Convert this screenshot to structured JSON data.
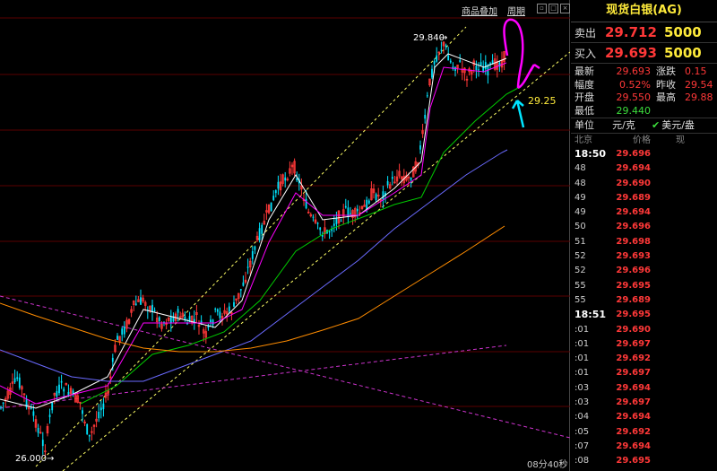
{
  "toolbar": {
    "btn_overlay": "商品叠加",
    "btn_period": "周期"
  },
  "chart": {
    "top_price_label": "29.840",
    "bottom_price_label": "26.000",
    "annotation": "29.25",
    "timer": "08分40秒",
    "colors": {
      "candle": "#ff3838",
      "ma_fast": "#ffffff",
      "ma2": "#ff00ff",
      "ma3": "#00cc00",
      "ma4": "#6a6aff",
      "ma5": "#ff8c00",
      "channel": "#ffff66",
      "trend": "#cc33cc",
      "annot": "#00e5ff",
      "mark": "#ff00ff"
    }
  },
  "side": {
    "title": "现货白银(AG)",
    "ask": {
      "label": "卖出",
      "price": "29.712",
      "volume": "5000"
    },
    "bid": {
      "label": "买入",
      "price": "29.693",
      "volume": "5000"
    },
    "stats": [
      {
        "l1": "最新",
        "v1": "29.693",
        "l2": "涨跌",
        "v2": "0.15"
      },
      {
        "l1": "幅度",
        "v1": "0.52%",
        "l2": "昨收",
        "v2": "29.54"
      },
      {
        "l1": "开盘",
        "v1": "29.550",
        "l2": "最高",
        "v2": "29.88"
      },
      {
        "l1": "最低",
        "v1": "29.440",
        "l2": "",
        "v2": ""
      }
    ],
    "unit": {
      "label": "单位",
      "value": "元/克",
      "option": "美元/盎"
    },
    "cols": {
      "c1": "北京",
      "c2": "价格",
      "c3": "现"
    },
    "ticks": [
      {
        "t": "18:50",
        "p": "29.696"
      },
      {
        "t": "48",
        "p": "29.694"
      },
      {
        "t": "48",
        "p": "29.690"
      },
      {
        "t": "49",
        "p": "29.689"
      },
      {
        "t": "49",
        "p": "29.694"
      },
      {
        "t": "50",
        "p": "29.696"
      },
      {
        "t": "51",
        "p": "29.698"
      },
      {
        "t": "52",
        "p": "29.693"
      },
      {
        "t": "52",
        "p": "29.696"
      },
      {
        "t": "55",
        "p": "29.695"
      },
      {
        "t": "55",
        "p": "29.689"
      },
      {
        "t": "18:51",
        "p": "29.695"
      },
      {
        "t": ":01",
        "p": "29.690"
      },
      {
        "t": ":01",
        "p": "29.697"
      },
      {
        "t": ":01",
        "p": "29.692"
      },
      {
        "t": ":01",
        "p": "29.697"
      },
      {
        "t": ":03",
        "p": "29.694"
      },
      {
        "t": ":03",
        "p": "29.697"
      },
      {
        "t": ":04",
        "p": "29.694"
      },
      {
        "t": ":05",
        "p": "29.692"
      },
      {
        "t": ":07",
        "p": "29.694"
      },
      {
        "t": ":08",
        "p": "29.695"
      }
    ]
  }
}
